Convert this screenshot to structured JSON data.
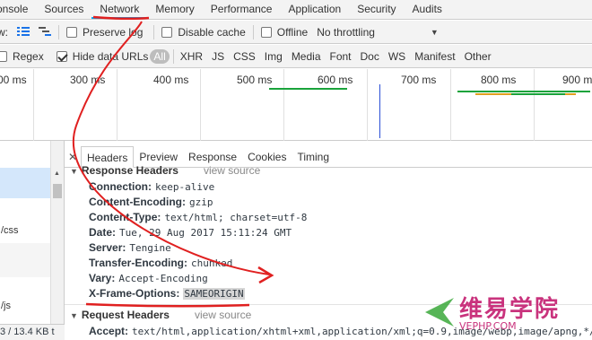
{
  "tabs": [
    {
      "label": "onsole"
    },
    {
      "label": "Sources"
    },
    {
      "label": "Network",
      "active": true
    },
    {
      "label": "Memory"
    },
    {
      "label": "Performance"
    },
    {
      "label": "Application"
    },
    {
      "label": "Security"
    },
    {
      "label": "Audits"
    }
  ],
  "toolbar": {
    "view_label": "w:",
    "preserve_log": "Preserve log",
    "disable_cache": "Disable cache",
    "offline": "Offline",
    "throttling": "No throttling"
  },
  "filter": {
    "regex": "Regex",
    "hide_data_urls": "Hide data URLs",
    "types": [
      "All",
      "XHR",
      "JS",
      "CSS",
      "Img",
      "Media",
      "Font",
      "Doc",
      "WS",
      "Manifest",
      "Other"
    ]
  },
  "timeline": {
    "ticks": [
      "00 ms",
      "300 ms",
      "400 ms",
      "500 ms",
      "600 ms",
      "700 ms",
      "800 ms",
      "900 m"
    ]
  },
  "left_pane": {
    "rows": [
      "/css",
      "/js"
    ],
    "status": "3 / 13.4 KB t"
  },
  "details": {
    "tabs": [
      "Headers",
      "Preview",
      "Response",
      "Cookies",
      "Timing"
    ],
    "response_section": {
      "title": "Response Headers",
      "view_source": "view source"
    },
    "response_headers": [
      {
        "key": "Connection:",
        "value": "keep-alive"
      },
      {
        "key": "Content-Encoding:",
        "value": "gzip"
      },
      {
        "key": "Content-Type:",
        "value": "text/html; charset=utf-8"
      },
      {
        "key": "Date:",
        "value": "Tue, 29 Aug 2017 15:11:24 GMT"
      },
      {
        "key": "Server:",
        "value": "Tengine"
      },
      {
        "key": "Transfer-Encoding:",
        "value": "chunked"
      },
      {
        "key": "Vary:",
        "value": "Accept-Encoding"
      },
      {
        "key": "X-Frame-Options:",
        "value": "SAMEORIGIN"
      }
    ],
    "request_section": {
      "title": "Request Headers",
      "view_source": "view source"
    },
    "request_headers": [
      {
        "key": "Accept:",
        "value": "text/html,application/xhtml+xml,application/xml;q=0.9,image/webp,image/apng,*/"
      }
    ]
  },
  "watermark": {
    "cn": "维易学院",
    "url": "VEPHP.COM"
  },
  "colors": {
    "accent": "#03a9f4",
    "annotation": "#e02020",
    "watermark": "#c9337d",
    "bar_green": "#1aa33b",
    "bar_blue": "#2b4fd6",
    "bar_orange": "#e0a020"
  }
}
